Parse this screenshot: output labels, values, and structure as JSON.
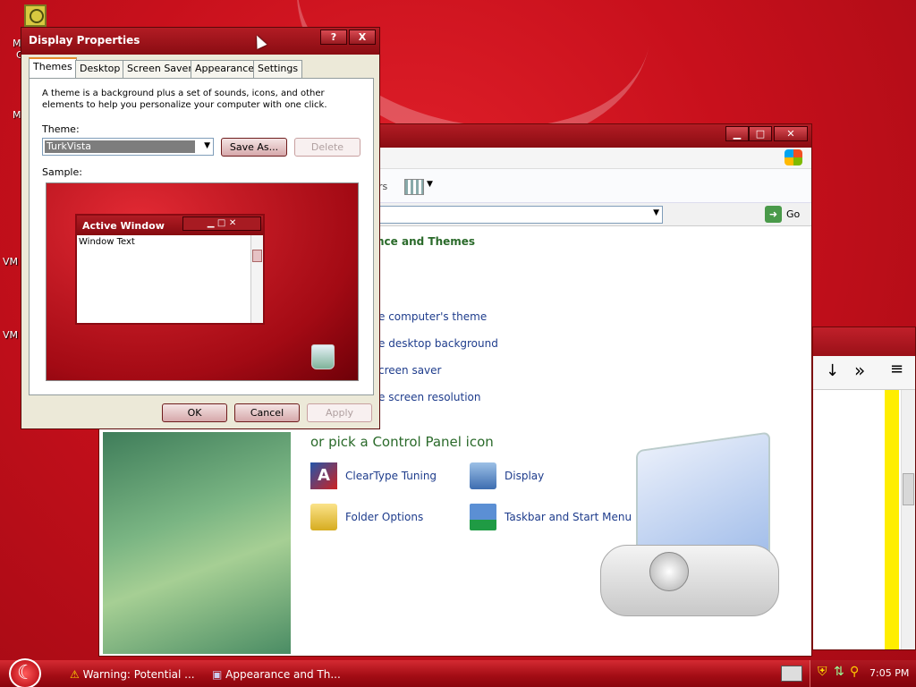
{
  "desktop": {
    "labels": [
      "M",
      "C",
      "M",
      "VM",
      "VM"
    ]
  },
  "control_panel": {
    "title": "",
    "toolbar_fragment": "rs",
    "address_go": "Go",
    "heading_fragment": "nce and Themes",
    "tasks": [
      "e computer's theme",
      "e desktop background",
      "creen saver",
      "e screen resolution"
    ],
    "pick_icon_heading": "or pick a Control Panel icon",
    "icons": [
      {
        "label": "ClearType Tuning",
        "icon": "cleartype-icon"
      },
      {
        "label": "Display",
        "icon": "display-icon"
      },
      {
        "label": "Folder Options",
        "icon": "folder-options-icon"
      },
      {
        "label": "Taskbar and Start Menu",
        "icon": "taskbar-icon"
      }
    ]
  },
  "dialog": {
    "title": "Display Properties",
    "help_btn": "?",
    "close_btn": "X",
    "tabs": [
      "Themes",
      "Desktop",
      "Screen Saver",
      "Appearance",
      "Settings"
    ],
    "description": "A theme is a background plus a set of sounds, icons, and other elements to help you personalize your computer with one click.",
    "theme_label": "Theme:",
    "theme_value": "TurkVista",
    "save_as": "Save As...",
    "delete": "Delete",
    "sample_label": "Sample:",
    "preview": {
      "active_window_title": "Active Window",
      "window_text": "Window Text"
    },
    "ok": "OK",
    "cancel": "Cancel",
    "apply": "Apply"
  },
  "taskbar": {
    "tasks": [
      {
        "label": "Warning: Potential ...",
        "icon": "warning-icon"
      },
      {
        "label": "Appearance and Th...",
        "icon": "folder-icon"
      }
    ],
    "clock": "7:05 PM"
  },
  "colors": {
    "desktop": "#c8101c",
    "title_active": "#a01820",
    "link": "#1e3c8c",
    "heading_green": "#2a6a2a"
  }
}
